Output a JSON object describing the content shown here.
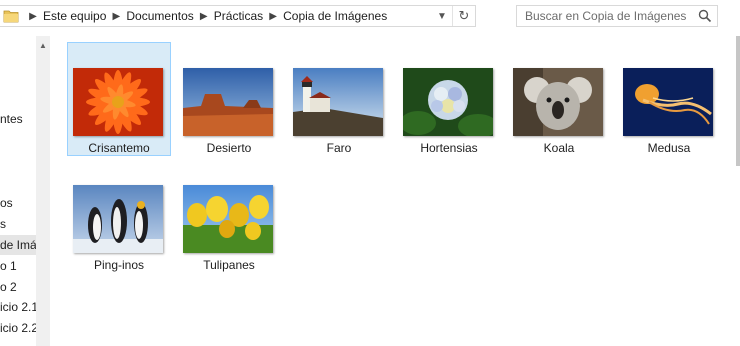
{
  "address_bar": {
    "crumbs": [
      "Este equipo",
      "Documentos",
      "Prácticas",
      "Copia de Imágenes"
    ]
  },
  "search": {
    "placeholder": "Buscar en Copia de Imágenes"
  },
  "nav_pane": {
    "items": [
      "ntes",
      "os",
      "s",
      "de Imá",
      "o 1",
      "o 2",
      "icio 2.1",
      "icio 2.2"
    ]
  },
  "files": [
    {
      "name": "Crisantemo",
      "thumb": "chrysanthemum-thumbnail",
      "selected": true
    },
    {
      "name": "Desierto",
      "thumb": "desert-thumbnail"
    },
    {
      "name": "Faro",
      "thumb": "lighthouse-thumbnail"
    },
    {
      "name": "Hortensias",
      "thumb": "hydrangeas-thumbnail"
    },
    {
      "name": "Koala",
      "thumb": "koala-thumbnail"
    },
    {
      "name": "Medusa",
      "thumb": "jellyfish-thumbnail"
    },
    {
      "name": "Ping-inos",
      "thumb": "penguins-thumbnail"
    },
    {
      "name": "Tulipanes",
      "thumb": "tulips-thumbnail"
    }
  ],
  "colors": {
    "selection_fill": "#d9ebf7",
    "selection_border": "#99d1ff",
    "folder_icon": "#e8c35a"
  },
  "icons": {
    "folder": "folder-icon",
    "separator": "chevron-right-icon",
    "dropdown": "chevron-down-icon",
    "refresh": "refresh-icon",
    "search": "search-icon",
    "scroll_up": "scroll-up-arrow-icon"
  }
}
